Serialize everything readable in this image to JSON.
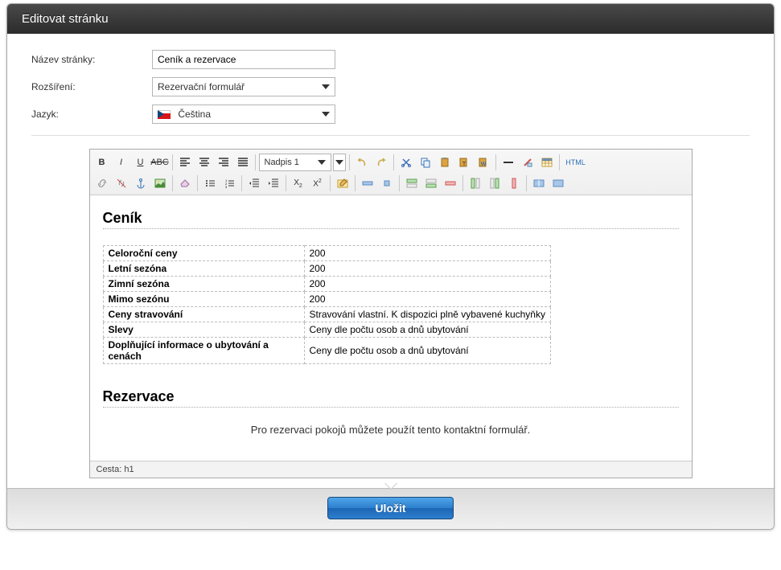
{
  "dialog": {
    "title": "Editovat stránku"
  },
  "form": {
    "pageNameLabel": "Název stránky:",
    "pageNameValue": "Ceník a rezervace",
    "extensionLabel": "Rozšíření:",
    "extensionValue": "Rezervační formulář",
    "languageLabel": "Jazyk:",
    "languageValue": "Čeština"
  },
  "toolbar": {
    "formatSelect": "Nadpis 1",
    "htmlLabel": "HTML"
  },
  "content": {
    "heading1": "Ceník",
    "heading2": "Rezervace",
    "reservationText": "Pro rezervaci pokojů můžete použít tento kontaktní formulář.",
    "rows": [
      {
        "k": "Celoroční ceny",
        "v": "200"
      },
      {
        "k": "Letní sezóna",
        "v": "200"
      },
      {
        "k": "Zimní sezóna",
        "v": "200"
      },
      {
        "k": "Mimo sezónu",
        "v": "200"
      },
      {
        "k": "Ceny stravování",
        "v": "Stravování vlastní. K dispozici plně vybavené kuchyňky"
      },
      {
        "k": "Slevy",
        "v": "Ceny dle počtu osob a dnů ubytování"
      },
      {
        "k": "Doplňující informace o ubytování a cenách",
        "v": "Ceny dle počtu osob a dnů ubytování"
      }
    ]
  },
  "statusBar": {
    "text": "Cesta: h1"
  },
  "footer": {
    "saveLabel": "Uložit"
  },
  "colors": {
    "primary": "#2d7fce",
    "headerDark": "#333333"
  }
}
